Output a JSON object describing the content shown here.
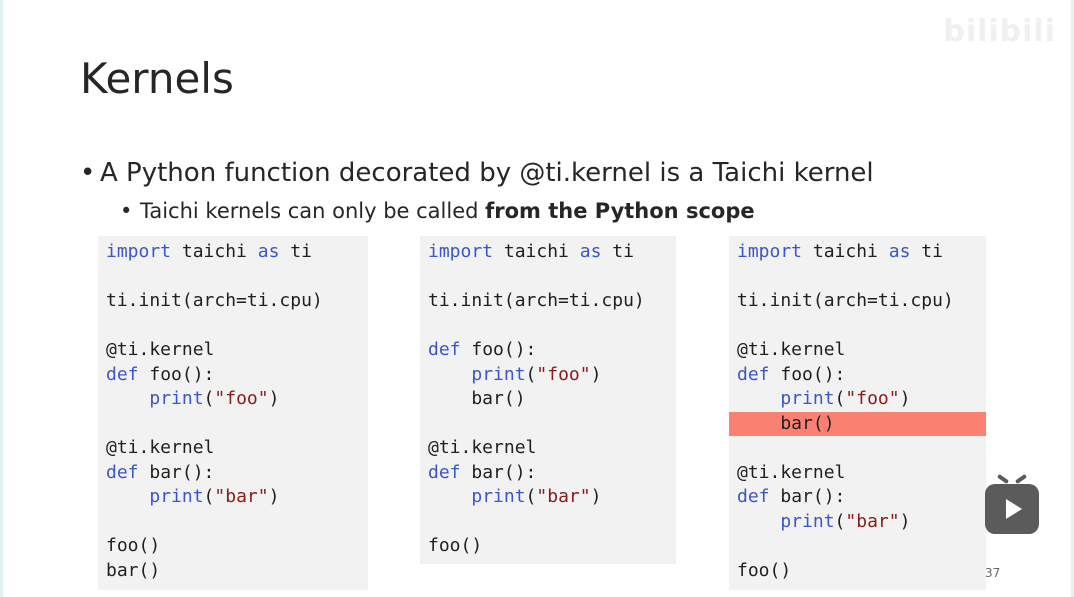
{
  "slide": {
    "title": "Kernels",
    "bullet1": "A Python function decorated by @ti.kernel is a Taichi kernel",
    "bullet2_prefix": "Taichi kernels can only be called ",
    "bullet2_bold": "from the Python scope",
    "page_number": "37"
  },
  "watermark": "bilibili",
  "code_blocks": [
    [
      [
        {
          "t": "import",
          "c": "kw"
        },
        {
          "t": " taichi "
        },
        {
          "t": "as",
          "c": "kw"
        },
        {
          "t": " ti"
        }
      ],
      [],
      [
        {
          "t": "ti.init(arch=ti.cpu)"
        }
      ],
      [],
      [
        {
          "t": "@ti.kernel"
        }
      ],
      [
        {
          "t": "def",
          "c": "kw"
        },
        {
          "t": " foo():"
        }
      ],
      [
        {
          "t": "    "
        },
        {
          "t": "print",
          "c": "kw"
        },
        {
          "t": "("
        },
        {
          "t": "\"foo\"",
          "c": "str"
        },
        {
          "t": ")"
        }
      ],
      [],
      [
        {
          "t": "@ti.kernel"
        }
      ],
      [
        {
          "t": "def",
          "c": "kw"
        },
        {
          "t": " bar():"
        }
      ],
      [
        {
          "t": "    "
        },
        {
          "t": "print",
          "c": "kw"
        },
        {
          "t": "("
        },
        {
          "t": "\"bar\"",
          "c": "str"
        },
        {
          "t": ")"
        }
      ],
      [],
      [
        {
          "t": "foo()"
        }
      ],
      [
        {
          "t": "bar()"
        }
      ]
    ],
    [
      [
        {
          "t": "import",
          "c": "kw"
        },
        {
          "t": " taichi "
        },
        {
          "t": "as",
          "c": "kw"
        },
        {
          "t": " ti"
        }
      ],
      [],
      [
        {
          "t": "ti.init(arch=ti.cpu)"
        }
      ],
      [],
      [
        {
          "t": "def",
          "c": "kw"
        },
        {
          "t": " foo():"
        }
      ],
      [
        {
          "t": "    "
        },
        {
          "t": "print",
          "c": "kw"
        },
        {
          "t": "("
        },
        {
          "t": "\"foo\"",
          "c": "str"
        },
        {
          "t": ")"
        }
      ],
      [
        {
          "t": "    bar()"
        }
      ],
      [],
      [
        {
          "t": "@ti.kernel"
        }
      ],
      [
        {
          "t": "def",
          "c": "kw"
        },
        {
          "t": " bar():"
        }
      ],
      [
        {
          "t": "    "
        },
        {
          "t": "print",
          "c": "kw"
        },
        {
          "t": "("
        },
        {
          "t": "\"bar\"",
          "c": "str"
        },
        {
          "t": ")"
        }
      ],
      [],
      [
        {
          "t": "foo()"
        }
      ]
    ],
    [
      [
        {
          "t": "import",
          "c": "kw"
        },
        {
          "t": " taichi "
        },
        {
          "t": "as",
          "c": "kw"
        },
        {
          "t": " ti"
        }
      ],
      [],
      [
        {
          "t": "ti.init(arch=ti.cpu)"
        }
      ],
      [],
      [
        {
          "t": "@ti.kernel"
        }
      ],
      [
        {
          "t": "def",
          "c": "kw"
        },
        {
          "t": " foo():"
        }
      ],
      [
        {
          "t": "    "
        },
        {
          "t": "print",
          "c": "kw"
        },
        {
          "t": "("
        },
        {
          "t": "\"foo\"",
          "c": "str"
        },
        {
          "t": ")"
        }
      ],
      [
        {
          "t": "    bar()",
          "hl": true
        }
      ],
      [],
      [
        {
          "t": "@ti.kernel"
        }
      ],
      [
        {
          "t": "def",
          "c": "kw"
        },
        {
          "t": " bar():"
        }
      ],
      [
        {
          "t": "    "
        },
        {
          "t": "print",
          "c": "kw"
        },
        {
          "t": "("
        },
        {
          "t": "\"bar\"",
          "c": "str"
        },
        {
          "t": ")"
        }
      ],
      [],
      [
        {
          "t": "foo()"
        }
      ]
    ]
  ],
  "highlight": {
    "block": 2,
    "line": 7,
    "color": "#fa8072"
  },
  "colors": {
    "keyword": "#3a56c8",
    "string": "#8a1a1a",
    "code_bg": "#f2f2f2"
  },
  "player": {
    "icon": "play-icon"
  }
}
